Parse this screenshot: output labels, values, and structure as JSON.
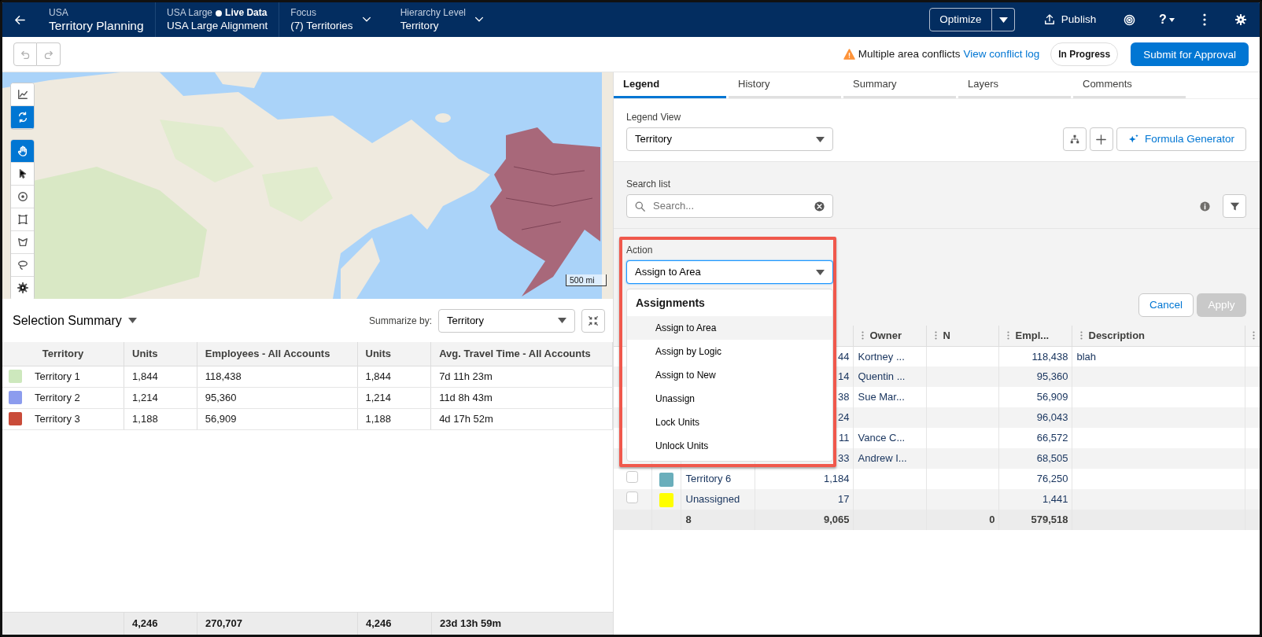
{
  "header": {
    "app": {
      "eyebrow": "USA",
      "title": "Territory Planning"
    },
    "alignment": {
      "eyebrow": "USA Large",
      "status": "Live Data",
      "title": "USA Large Alignment"
    },
    "pickers": [
      {
        "label": "Focus",
        "value": "(7) Territories"
      },
      {
        "label": "Hierarchy Level",
        "value": "Territory"
      }
    ],
    "optimize": "Optimize",
    "publish": "Publish",
    "help": "?"
  },
  "toolbar": {
    "alert": "Multiple area conflicts",
    "alert_link": "View conflict log",
    "status": "In Progress",
    "submit": "Submit for Approval"
  },
  "map": {
    "tool_groups": [
      [
        {
          "selected": false
        },
        {
          "selected": true
        }
      ],
      [
        {
          "selected": true
        },
        {
          "selected": false
        },
        {
          "selected": false
        },
        {
          "selected": false
        },
        {
          "selected": false
        },
        {
          "selected": false
        },
        {
          "selected": false
        }
      ]
    ],
    "scale": "500 mi"
  },
  "selection_summary": {
    "title": "Selection Summary",
    "summarize_label": "Summarize by:",
    "summarize_value": "Territory",
    "columns": [
      "Territory",
      "Units",
      "Employees - All Accounts",
      "Units",
      "Avg. Travel Time - All Accounts"
    ],
    "rows": [
      {
        "color": "#cde8bd",
        "cells": [
          "Territory 1",
          "1,844",
          "118,438",
          "1,844",
          "7d 11h 23m"
        ]
      },
      {
        "color": "#8c9cee",
        "cells": [
          "Territory 2",
          "1,214",
          "95,360",
          "1,214",
          "11d 8h 43m"
        ]
      },
      {
        "color": "#c94b39",
        "cells": [
          "Territory 3",
          "1,188",
          "56,909",
          "1,188",
          "4d 17h 52m"
        ]
      }
    ],
    "totals": [
      "4,246",
      "270,707",
      "4,246",
      "23d 13h 59m"
    ]
  },
  "legend_panel": {
    "tabs": [
      {
        "label": "Legend",
        "selected": true
      },
      {
        "label": "History",
        "selected": false
      },
      {
        "label": "Summary",
        "selected": false
      },
      {
        "label": "Layers",
        "selected": false
      },
      {
        "label": "Comments",
        "selected": false
      }
    ],
    "legend_view": {
      "label": "Legend View",
      "value": "Territory"
    },
    "formula_button": "Formula Generator",
    "search": {
      "label": "Search list",
      "placeholder": "Search..."
    },
    "action": {
      "label": "Action",
      "value": "Assign to Area",
      "callout": true,
      "menu_heading": "Assignments",
      "options": [
        {
          "label": "Assign to Area",
          "highlighted": true
        },
        {
          "label": "Assign by Logic",
          "highlighted": false
        },
        {
          "label": "Assign to New",
          "highlighted": false
        },
        {
          "label": "Unassign",
          "highlighted": false
        },
        {
          "label": "Lock Units",
          "highlighted": false
        },
        {
          "label": "Unlock Units",
          "highlighted": false
        }
      ]
    },
    "cancel": "Cancel",
    "apply": {
      "label": "Apply",
      "disabled": true
    },
    "table": {
      "columns": [
        "Owner",
        "N",
        "Empl...",
        "Description"
      ],
      "rows": [
        {
          "units": "44",
          "owner": "Kortney ...",
          "employees": "118,438",
          "description": "blah"
        },
        {
          "units": "14",
          "owner": "Quentin ...",
          "employees": "95,360"
        },
        {
          "units": "38",
          "owner": "Sue Mar...",
          "employees": "56,909"
        },
        {
          "units": "24",
          "employees": "96,043"
        },
        {
          "units": "11",
          "owner": "Vance C...",
          "employees": "66,572"
        },
        {
          "units": "33",
          "owner": "Andrew I...",
          "employees": "68,505"
        },
        {
          "checked": false,
          "color": "#6aaebb",
          "name": "Territory 6",
          "units": "1,184",
          "employees": "76,250"
        },
        {
          "checked": false,
          "color": "#ffff00",
          "name": "Unassigned",
          "units": "17",
          "employees": "1,441"
        }
      ],
      "totals": {
        "name": "8",
        "units": "9,065",
        "n": "0",
        "employees": "579,518"
      }
    }
  }
}
